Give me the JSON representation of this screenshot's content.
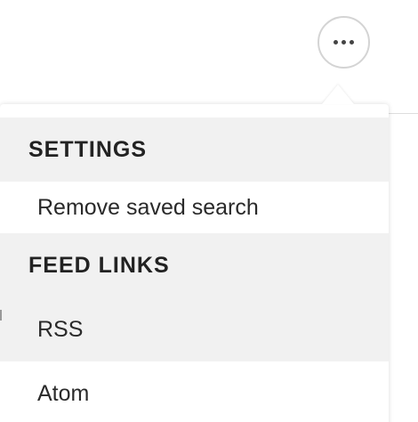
{
  "more_button": {
    "icon": "more-horizontal-icon"
  },
  "menu": {
    "sections": [
      {
        "title": "SETTINGS",
        "items": [
          "Remove saved search"
        ]
      },
      {
        "title": "FEED LINKS",
        "items": [
          "RSS",
          "Atom"
        ]
      }
    ]
  }
}
